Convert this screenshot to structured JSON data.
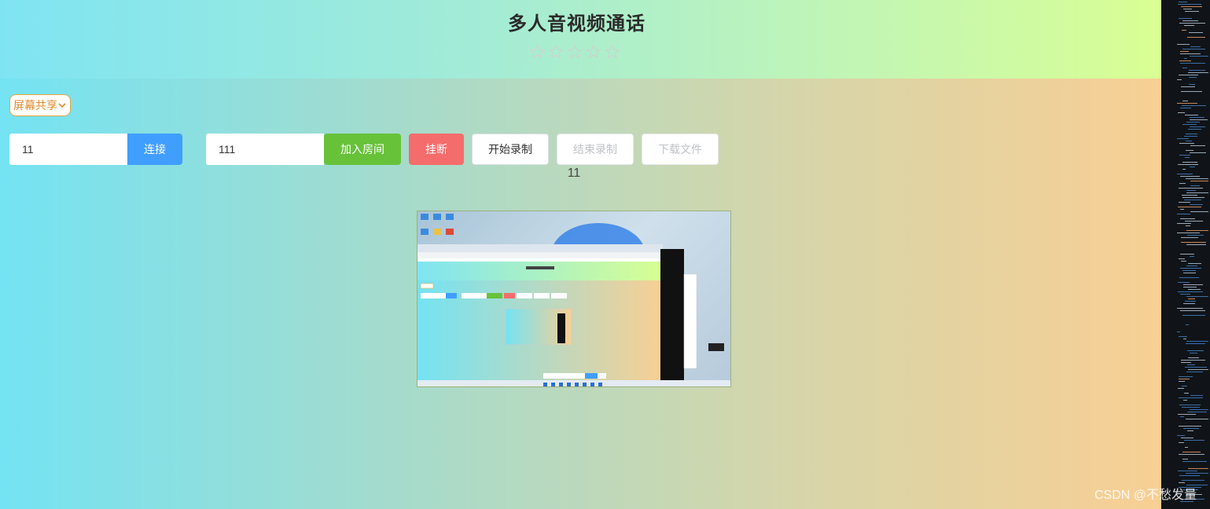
{
  "header": {
    "title": "多人音视频通话",
    "rating_stars": 5
  },
  "source_select": {
    "selected": "屏幕共享"
  },
  "connect": {
    "input_value": "11",
    "button_label": "连接"
  },
  "room": {
    "input_value": "111",
    "join_label": "加入房间",
    "hangup_label": "挂断"
  },
  "recording": {
    "start_label": "开始录制",
    "stop_label": "结束录制",
    "download_label": "下载文件"
  },
  "peer": {
    "label": "11"
  },
  "colors": {
    "primary": "#409eff",
    "success": "#67c23a",
    "danger": "#f56c6c",
    "select_border": "#e7a53c"
  },
  "icons": {
    "star": "star-outline-icon",
    "chevron": "chevron-down-icon"
  },
  "watermark": "CSDN @不愁发量"
}
